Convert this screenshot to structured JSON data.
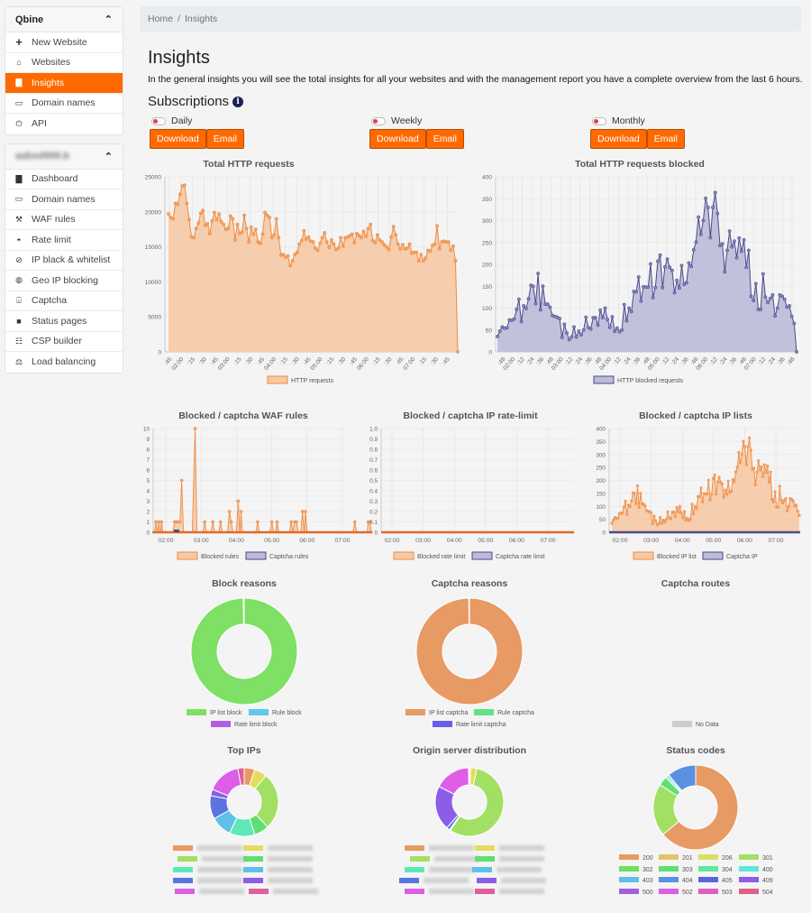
{
  "sidebar": {
    "org_card": {
      "title": "Qbine",
      "items": [
        {
          "label": "New Website",
          "icon": "plus-icon"
        },
        {
          "label": "Websites",
          "icon": "home-icon"
        },
        {
          "label": "Insights",
          "icon": "bar-chart-icon",
          "active": true
        },
        {
          "label": "Domain names",
          "icon": "monitor-icon"
        },
        {
          "label": "API",
          "icon": "plug-icon"
        }
      ]
    },
    "site_card": {
      "title": "aabsd999.b",
      "items": [
        {
          "label": "Dashboard",
          "icon": "bar-chart-icon"
        },
        {
          "label": "Domain names",
          "icon": "monitor-icon"
        },
        {
          "label": "WAF rules",
          "icon": "gavel-icon"
        },
        {
          "label": "Rate limit",
          "icon": "gauge-icon"
        },
        {
          "label": "IP black & whitelist",
          "icon": "ban-icon"
        },
        {
          "label": "Geo IP blocking",
          "icon": "globe-icon"
        },
        {
          "label": "Captcha",
          "icon": "robot-icon"
        },
        {
          "label": "Status pages",
          "icon": "file-icon"
        },
        {
          "label": "CSP builder",
          "icon": "sitemap-icon"
        },
        {
          "label": "Load balancing",
          "icon": "balance-scale-icon"
        }
      ]
    }
  },
  "breadcrumb": {
    "home": "Home",
    "separator": "/",
    "current": "Insights"
  },
  "page": {
    "title": "Insights",
    "description": "In the general insights you will see the total insights for all your websites and with the management report you have a complete overview from the last 6 hours.",
    "subscriptions_label": "Subscriptions",
    "subscriptions": [
      {
        "label": "Daily",
        "enabled": false,
        "download": "Download",
        "email": "Email"
      },
      {
        "label": "Weekly",
        "enabled": false,
        "download": "Download",
        "email": "Email"
      },
      {
        "label": "Monthly",
        "enabled": false,
        "download": "Download",
        "email": "Email"
      }
    ]
  },
  "colors": {
    "accent": "#ff6a00",
    "orange_line": "#ef8a3f",
    "orange_fill": "#f6c9a5",
    "purple_line": "#4b4a8a",
    "purple_fill": "#bcbbd9"
  },
  "chart_data": [
    {
      "id": "total_http",
      "type": "area",
      "title": "Total HTTP requests",
      "legend": [
        "HTTP requests"
      ],
      "ylim": [
        0,
        25000
      ],
      "yticks": [
        0,
        5000,
        10000,
        15000,
        20000,
        25000
      ],
      "xtick_labels": [
        ":45",
        "02:00",
        ":15",
        ":30",
        ":45",
        "03:00",
        ":15",
        ":30",
        ":45",
        "04:00",
        ":15",
        ":30",
        ":45",
        "05:00",
        ":15",
        ":30",
        ":45",
        "06:00",
        ":15",
        ":30",
        ":45",
        "07:00",
        ":15",
        ":30",
        ":45"
      ],
      "values": [
        19700,
        19200,
        19000,
        21200,
        21100,
        22500,
        23700,
        23800,
        21200,
        18900,
        16400,
        16300,
        17600,
        18400,
        19800,
        20200,
        18100,
        18300,
        16900,
        18700,
        19900,
        18900,
        19700,
        18600,
        18200,
        17500,
        17600,
        19400,
        19000,
        16000,
        18200,
        16900,
        17100,
        19500,
        17600,
        15700,
        17800,
        16800,
        17500,
        15700,
        15500,
        16800,
        19900,
        19500,
        19200,
        16300,
        16700,
        19000,
        16300,
        13800,
        13900,
        13500,
        13700,
        12300,
        13000,
        13900,
        14200,
        15400,
        15900,
        17300,
        16100,
        16400,
        15800,
        15700,
        14800,
        14500,
        15500,
        16300,
        17000,
        15700,
        14900,
        16000,
        15400,
        14600,
        14800,
        16300,
        15100,
        16300,
        16400,
        16600,
        16800,
        15600,
        16900,
        16600,
        16300,
        17200,
        16500,
        17600,
        18200,
        15900,
        15600,
        16700,
        16000,
        15700,
        15300,
        15000,
        14600,
        16400,
        17900,
        16700,
        15400,
        14700,
        15300,
        14700,
        14800,
        15400,
        14100,
        14200,
        14200,
        13000,
        13900,
        13000,
        13400,
        14500,
        14400,
        15200,
        15400,
        18000,
        14700,
        15700,
        15800,
        15700,
        15700,
        14500,
        15100,
        13000,
        0
      ]
    },
    {
      "id": "total_blocked",
      "type": "area",
      "title": "Total HTTP requests blocked",
      "legend": [
        "HTTP blocked requests"
      ],
      "ylim": [
        0,
        400
      ],
      "yticks": [
        0,
        50,
        100,
        150,
        200,
        250,
        300,
        350,
        400
      ],
      "xtick_labels": [
        ":48",
        "02:00",
        ":12",
        ":24",
        ":36",
        ":48",
        "03:00",
        ":12",
        ":24",
        ":36",
        ":48",
        "04:00",
        ":12",
        ":24",
        ":36",
        ":48",
        "05:00",
        ":12",
        ":24",
        ":36",
        ":48",
        "06:00",
        ":12",
        ":24",
        ":36",
        ":48",
        "07:00",
        ":12",
        ":24",
        ":36",
        ":48"
      ],
      "values": [
        35,
        47,
        57,
        54,
        55,
        73,
        72,
        75,
        97,
        120,
        69,
        105,
        99,
        121,
        152,
        150,
        110,
        179,
        96,
        150,
        109,
        109,
        102,
        83,
        81,
        79,
        76,
        33,
        63,
        43,
        28,
        34,
        57,
        34,
        47,
        39,
        50,
        79,
        56,
        52,
        78,
        78,
        61,
        95,
        78,
        100,
        74,
        56,
        80,
        47,
        54,
        46,
        50,
        108,
        71,
        100,
        92,
        138,
        137,
        171,
        116,
        149,
        148,
        148,
        201,
        124,
        147,
        207,
        221,
        147,
        194,
        212,
        193,
        186,
        135,
        163,
        146,
        197,
        154,
        158,
        203,
        195,
        233,
        251,
        308,
        268,
        300,
        351,
        330,
        261,
        330,
        364,
        316,
        243,
        247,
        183,
        232,
        276,
        240,
        253,
        215,
        260,
        230,
        256,
        193,
        232,
        127,
        117,
        156,
        97,
        97,
        178,
        125,
        113,
        122,
        130,
        82,
        100,
        130,
        127,
        120,
        102,
        105,
        81,
        65,
        0
      ]
    },
    {
      "id": "waf_rules",
      "type": "line",
      "title": "Blocked / captcha WAF rules",
      "legend": [
        "Blocked rules",
        "Captcha rules"
      ],
      "ylim": [
        0,
        10
      ],
      "yticks": [
        0,
        1,
        2,
        3,
        4,
        5,
        6,
        7,
        8,
        9,
        10
      ],
      "xtick_labels": [
        "02:00",
        "03:00",
        "04:00",
        "05:00",
        "06:00",
        "07:00"
      ],
      "x_range_hours": [
        1.62,
        7.85
      ],
      "series": [
        {
          "name": "Blocked rules",
          "points": [
            [
              1.62,
              0
            ],
            [
              1.68,
              0
            ],
            [
              1.72,
              1
            ],
            [
              1.76,
              0
            ],
            [
              1.8,
              1
            ],
            [
              1.84,
              0
            ],
            [
              1.88,
              1
            ],
            [
              1.92,
              0
            ],
            [
              2.2,
              0
            ],
            [
              2.25,
              1
            ],
            [
              2.3,
              1
            ],
            [
              2.35,
              1
            ],
            [
              2.4,
              1
            ],
            [
              2.45,
              5
            ],
            [
              2.5,
              0
            ],
            [
              2.75,
              0
            ],
            [
              2.83,
              10
            ],
            [
              2.88,
              0
            ],
            [
              3.05,
              0
            ],
            [
              3.1,
              1
            ],
            [
              3.15,
              0
            ],
            [
              3.28,
              0
            ],
            [
              3.33,
              1
            ],
            [
              3.38,
              0
            ],
            [
              3.5,
              0
            ],
            [
              3.55,
              1
            ],
            [
              3.6,
              0
            ],
            [
              3.75,
              0
            ],
            [
              3.8,
              2
            ],
            [
              3.85,
              1
            ],
            [
              3.9,
              0
            ],
            [
              4.0,
              0
            ],
            [
              4.05,
              3
            ],
            [
              4.1,
              0
            ],
            [
              4.13,
              2
            ],
            [
              4.17,
              0
            ],
            [
              4.55,
              0
            ],
            [
              4.6,
              1
            ],
            [
              4.65,
              0
            ],
            [
              4.95,
              0
            ],
            [
              5.0,
              1
            ],
            [
              5.05,
              0
            ],
            [
              5.1,
              0
            ],
            [
              5.15,
              1
            ],
            [
              5.2,
              0
            ],
            [
              5.5,
              0
            ],
            [
              5.55,
              1
            ],
            [
              5.6,
              0
            ],
            [
              5.65,
              1
            ],
            [
              5.7,
              1
            ],
            [
              5.75,
              0
            ],
            [
              5.82,
              0
            ],
            [
              5.87,
              2
            ],
            [
              5.92,
              0
            ],
            [
              5.95,
              2
            ],
            [
              6.0,
              0
            ],
            [
              7.3,
              0
            ],
            [
              7.35,
              1
            ],
            [
              7.4,
              0
            ],
            [
              7.7,
              0
            ],
            [
              7.73,
              1
            ],
            [
              7.78,
              1
            ],
            [
              7.82,
              0
            ],
            [
              7.85,
              0
            ]
          ]
        },
        {
          "name": "Captcha rules",
          "points": [
            [
              1.62,
              0
            ],
            [
              7.85,
              0
            ]
          ]
        }
      ]
    },
    {
      "id": "ip_rate_limit",
      "type": "line",
      "title": "Blocked / captcha IP rate-limit",
      "legend": [
        "Blocked rate limit",
        "Captcha rate limit"
      ],
      "ylim": [
        0,
        1.0
      ],
      "yticks": [
        0,
        0.1,
        0.2,
        0.3,
        0.4,
        0.5,
        0.6,
        0.7,
        0.8,
        0.9,
        1.0
      ],
      "xtick_labels": [
        "02:00",
        "03:00",
        "04:00",
        "05:00",
        "06:00",
        "07:00"
      ],
      "series": [
        {
          "name": "Blocked rate limit",
          "values": "all 0"
        },
        {
          "name": "Captcha rate limit",
          "values": "all 0"
        }
      ]
    },
    {
      "id": "ip_lists",
      "type": "area",
      "title": "Blocked / captcha IP lists",
      "legend": [
        "Blocked IP list",
        "Captcha IP"
      ],
      "ylim": [
        0,
        400
      ],
      "yticks": [
        0,
        50,
        100,
        150,
        200,
        250,
        300,
        350,
        400
      ],
      "xtick_labels": [
        "02:00",
        "03:00",
        "04:00",
        "05:00",
        "06:00",
        "07:00"
      ],
      "series_note": "Blocked IP list mirrors Total HTTP requests blocked; Captcha IP is 0 throughout"
    },
    {
      "id": "block_reasons",
      "type": "pie",
      "title": "Block reasons",
      "labels": [
        "IP list block",
        "Rule block",
        "Rate limit block"
      ],
      "values": [
        99.7,
        0.3,
        0
      ],
      "colors": [
        "#7ee064",
        "#62c7e8",
        "#b05ee8"
      ]
    },
    {
      "id": "captcha_reasons",
      "type": "pie",
      "title": "Captcha reasons",
      "labels": [
        "IP list captcha",
        "Rule captcha",
        "Rate limit captcha"
      ],
      "values": [
        99.8,
        0.2,
        0
      ],
      "colors": [
        "#e89a64",
        "#62e08a",
        "#6a5ee8"
      ]
    },
    {
      "id": "captcha_routes",
      "type": "pie",
      "title": "Captcha routes",
      "labels": [
        "No Data"
      ],
      "values": [],
      "colors": [
        "#cccccc"
      ]
    },
    {
      "id": "top_ips",
      "type": "pie",
      "title": "Top IPs",
      "labels": [
        "(redacted IP 1)",
        "(redacted IP 2)",
        "(redacted IP 3)",
        "(redacted IP 4)",
        "(redacted IP 5)",
        "(redacted IP 6)",
        "(redacted IP 7)",
        "(redacted IP 8)",
        "(redacted IP 9)",
        "(redacted IP 10)"
      ],
      "values": [
        5,
        6,
        27,
        7,
        12,
        10,
        11,
        3,
        16,
        3
      ],
      "colors": [
        "#e89a64",
        "#e4dc5e",
        "#a2e064",
        "#5ee070",
        "#5ee8b8",
        "#5ec0e8",
        "#5a74e0",
        "#8a5ee8",
        "#de5ee8",
        "#e05e9a"
      ]
    },
    {
      "id": "origin_servers",
      "type": "pie",
      "title": "Origin server distribution",
      "labels": [
        "(redacted 1)",
        "(redacted 2)",
        "(redacted 3)",
        "(redacted 4)",
        "(redacted 5)",
        "(redacted 6)",
        "(redacted 7)",
        "(redacted 8)",
        "(redacted 9)",
        "(redacted 10)"
      ],
      "values": [
        0.5,
        3,
        56,
        0,
        0,
        0.5,
        1.5,
        21,
        17,
        0.5
      ],
      "colors": [
        "#e89a64",
        "#e4dc5e",
        "#a2e064",
        "#5ee070",
        "#5ee8b8",
        "#5ec0e8",
        "#5a74e0",
        "#8a5ee8",
        "#de5ee8",
        "#e05e9a"
      ]
    },
    {
      "id": "status_codes",
      "type": "pie",
      "title": "Status codes",
      "labels": [
        "200",
        "201",
        "206",
        "301",
        "302",
        "303",
        "304",
        "400",
        "403",
        "404",
        "405",
        "409",
        "500",
        "502",
        "503",
        "504"
      ],
      "values": [
        64,
        0,
        0,
        20,
        0,
        3.5,
        0,
        0.8,
        0.7,
        11,
        0,
        0,
        0,
        0,
        0,
        0
      ],
      "colors": [
        "#e89a64",
        "#e4c46a",
        "#d8e066",
        "#a2e064",
        "#6ee05e",
        "#5ee070",
        "#5ee8a0",
        "#5ee8d8",
        "#5ec0e8",
        "#5a90e0",
        "#5a64e0",
        "#8a5ee8",
        "#a45ee0",
        "#de5ee8",
        "#e05ec0",
        "#e05e88"
      ]
    }
  ]
}
